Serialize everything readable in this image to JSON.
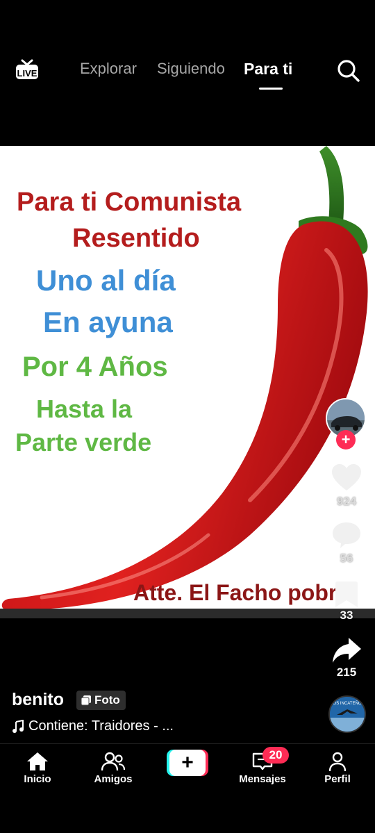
{
  "header": {
    "live_icon": "live-tv-icon",
    "live_label": "LIVE",
    "tabs": [
      {
        "label": "Explorar",
        "active": false
      },
      {
        "label": "Siguiendo",
        "active": false
      },
      {
        "label": "Para ti",
        "active": true
      }
    ],
    "search_icon": "search-icon"
  },
  "post": {
    "lines": [
      "Para ti Comunista",
      "Resentido",
      "Uno al día",
      "En ayuna",
      "Por 4 Años",
      "Hasta la",
      "Parte verde",
      "Atte. El Facho pobre"
    ],
    "colors": {
      "red_text": "#b41d1d",
      "blue_text": "#3f8fd6",
      "green_text": "#5fb844",
      "pepper": "#d8191c"
    }
  },
  "rail": {
    "follow_label": "+",
    "likes": "924",
    "comments": "56",
    "saves": "33",
    "shares": "215"
  },
  "caption": {
    "username": "benito",
    "badge": "Foto",
    "music": "Contiene: Traidores - ..."
  },
  "disc_text": "OS INCATEÑO",
  "nav": {
    "items": [
      {
        "label": "Inicio",
        "icon": "home-icon"
      },
      {
        "label": "Amigos",
        "icon": "friends-icon"
      },
      {
        "label": "Mensajes",
        "icon": "inbox-icon",
        "badge": "20"
      },
      {
        "label": "Perfil",
        "icon": "profile-icon"
      }
    ],
    "create_label": "+"
  },
  "accent": "#fe2c55"
}
